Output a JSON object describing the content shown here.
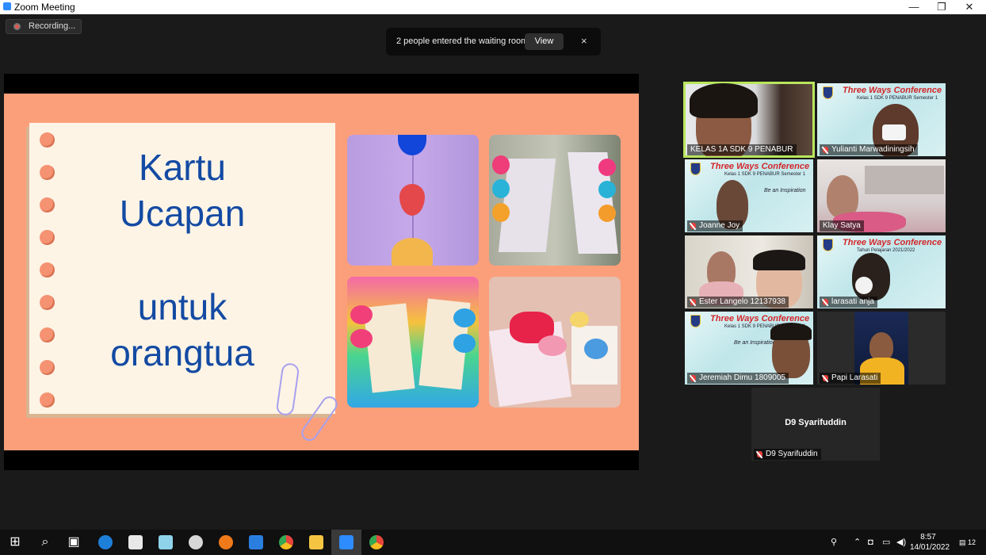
{
  "window": {
    "title": "Zoom Meeting",
    "minimize": "—",
    "restore": "❐",
    "close": "✕"
  },
  "recording": {
    "label": "Recording..."
  },
  "notification": {
    "message": "2 people entered the waiting room",
    "view_label": "View",
    "close_label": "×"
  },
  "slide": {
    "line1": "Kartu",
    "line2": "Ucapan",
    "line3": "untuk",
    "line4": "orangtua"
  },
  "conference_banner": {
    "title": "Three Ways Conference",
    "subtitle": "Kelas 1 SDK 9 PENABUR Semester 1",
    "subtitle2": "Tahun Pelajaran 2021/2022",
    "inspiration": "Be an Inspiration"
  },
  "participants": [
    {
      "name": "KELAS 1A SDK 9 PENABUR",
      "muted": false,
      "active": true
    },
    {
      "name": "Yulianti Marwadiningsih",
      "muted": true
    },
    {
      "name": "Joanne Joy",
      "muted": true
    },
    {
      "name": "Klay Satya",
      "muted": false
    },
    {
      "name": "Ester Langelo 12137938",
      "muted": true
    },
    {
      "name": "larasati anja",
      "muted": true
    },
    {
      "name": "Jeremiah Dimu 1809005",
      "muted": true
    },
    {
      "name": "Papi Larasati",
      "muted": true
    },
    {
      "name": "D9 Syarifuddin",
      "muted": true,
      "display": "D9 Syarifuddin"
    }
  ],
  "taskbar": {
    "icons": [
      "windows-start-icon",
      "search-icon",
      "task-view-icon",
      "edge-icon",
      "store-icon",
      "notes-icon",
      "paint-icon",
      "firefox-icon",
      "mail-icon",
      "chrome-icon",
      "file-explorer-icon",
      "zoom-icon",
      "chrome-profile-icon"
    ],
    "clock_time": "8:57",
    "clock_date": "14/01/2022",
    "notifications_count": "12"
  },
  "colors": {
    "slide_bg": "#fb9f7b",
    "slide_text": "#134aa3",
    "active_speaker": "#b8e65c",
    "banner_red": "#d3262a"
  }
}
